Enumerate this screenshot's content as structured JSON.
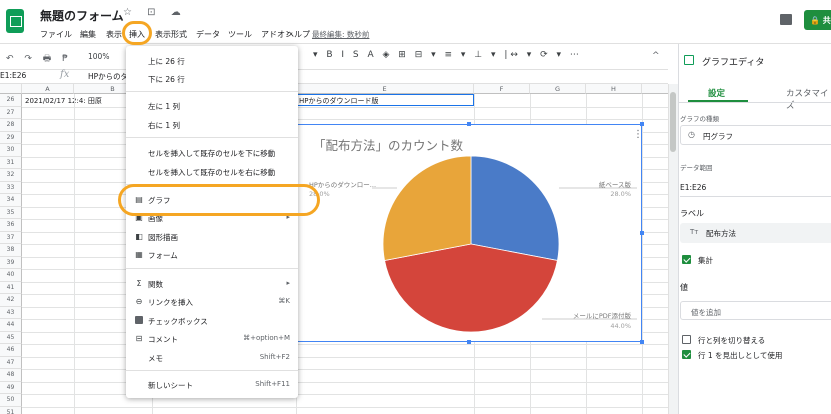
{
  "header": {
    "doc_title": "無題のフォーム",
    "title_icons": "☆ ⊡ ☁",
    "menus": [
      "ファイル",
      "編集",
      "表示",
      "挿入",
      "表示形式",
      "データ",
      "ツール",
      "アドオン",
      "ヘルプ"
    ],
    "last_edit": "最終編集: 数秒前",
    "share_label": "共有"
  },
  "toolbar": {
    "left_icons": "↶ ↷ 🖶 ₱",
    "zoom": "100%",
    "right_icons": "▾ B I S A ◈ ⊞ ⊟ ▾ ≡ ▾ ⊥ ▾ |↔ ▾ ⟳ ▾ ⋯",
    "chevron": "^"
  },
  "formula_bar": {
    "name_box": "E1:E26",
    "fx": "fx",
    "value": "HPからのダ"
  },
  "sheet": {
    "columns": [
      "A",
      "B",
      "E",
      "F",
      "G",
      "H"
    ],
    "rows": [
      "26",
      "27",
      "28",
      "29",
      "30",
      "31",
      "32",
      "33",
      "34",
      "35",
      "36",
      "37",
      "38",
      "39",
      "40",
      "41",
      "42",
      "43",
      "44",
      "45",
      "46",
      "47",
      "48",
      "49",
      "50",
      "51"
    ],
    "cell_a26": "2021/02/17 12:4: 田原",
    "cell_e26": "HPからのダウンロード版"
  },
  "chart_data": {
    "type": "pie",
    "title": "「配布方法」のカウント数",
    "slices": [
      {
        "label": "紙ベース版",
        "percent": 28.0,
        "color": "#4a7bc8"
      },
      {
        "label": "メールにPDF添付版",
        "percent": 44.0,
        "color": "#d4453b"
      },
      {
        "label": "HPからのダウンロー...",
        "percent": 28.0,
        "color": "#e8a53a"
      }
    ],
    "slice_labels": [
      {
        "name": "紙ベース版",
        "pct": "28.0%"
      },
      {
        "name": "メールにPDF添付版",
        "pct": "44.0%"
      },
      {
        "name": "HPからのダウンロー...",
        "pct": "28.0%"
      }
    ]
  },
  "menu": {
    "items": [
      {
        "label": "上に 26 行",
        "shortcut": "",
        "icon": ""
      },
      {
        "label": "下に 26 行",
        "shortcut": "",
        "icon": ""
      },
      {
        "label": "左に 1 列",
        "shortcut": "",
        "icon": ""
      },
      {
        "label": "右に 1 列",
        "shortcut": "",
        "icon": ""
      },
      {
        "label": "セルを挿入して既存のセルを下に移動",
        "shortcut": "",
        "icon": ""
      },
      {
        "label": "セルを挿入して既存のセルを右に移動",
        "shortcut": "",
        "icon": ""
      },
      {
        "label": "グラフ",
        "shortcut": "",
        "icon": "chart"
      },
      {
        "label": "画像",
        "shortcut": "▸",
        "icon": "image"
      },
      {
        "label": "図形描画",
        "shortcut": "",
        "icon": "drawing"
      },
      {
        "label": "フォーム",
        "shortcut": "",
        "icon": "form"
      },
      {
        "label": "関数",
        "shortcut": "▸",
        "icon": "sigma"
      },
      {
        "label": "リンクを挿入",
        "shortcut": "⌘K",
        "icon": "link"
      },
      {
        "label": "チェックボックス",
        "shortcut": "",
        "icon": "checkbox"
      },
      {
        "label": "コメント",
        "shortcut": "⌘+option+M",
        "icon": "comment"
      },
      {
        "label": "メモ",
        "shortcut": "Shift+F2",
        "icon": ""
      },
      {
        "label": "新しいシート",
        "shortcut": "Shift+F11",
        "icon": ""
      }
    ]
  },
  "editor": {
    "title": "グラフエディタ",
    "tab_setup": "設定",
    "tab_customize": "カスタマイズ",
    "chart_type_label": "グラフの種類",
    "chart_type_value": "円グラフ",
    "data_range_label": "データ範囲",
    "data_range_value": "E1:E26",
    "label_heading": "ラベル",
    "label_value": "配布方法",
    "aggregate_label": "集計",
    "value_heading": "値",
    "add_value": "値を追加",
    "switch_rows_cols": "行と列を切り替える",
    "use_row1_header": "行 1 を見出しとして使用"
  },
  "colors": {
    "accent_green": "#1e8e3e",
    "highlight_orange": "#f5a623",
    "selection_blue": "#1a73e8"
  }
}
